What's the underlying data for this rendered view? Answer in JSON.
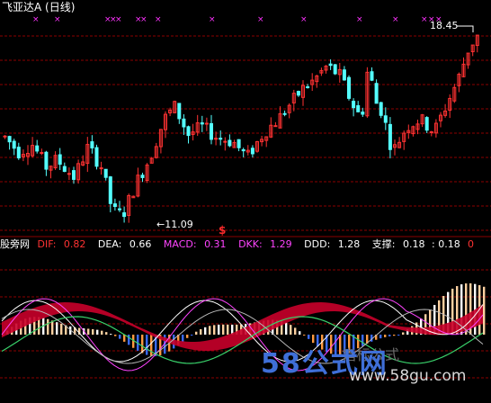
{
  "window": {
    "title": "飞亚达A (日线)"
  },
  "price_panel": {
    "high_label": "18.45",
    "low_label": "←11.09",
    "signal_marker": "$"
  },
  "indicator_panel": {
    "name": "股旁网",
    "items": [
      {
        "label": "DIF:",
        "value": "0.82",
        "color": "#ff3333"
      },
      {
        "label": "DEA:",
        "value": "0.66",
        "color": "#ffffff"
      },
      {
        "label": "MACD:",
        "value": "0.31",
        "color": "#ff44ff"
      },
      {
        "label": "DKK:",
        "value": "1.29",
        "color": "#ff44ff"
      },
      {
        "label": "DDD:",
        "value": "1.28",
        "color": "#ffffff"
      },
      {
        "label": "支撑:",
        "value": "0.18",
        "color": "#ffee55"
      }
    ],
    "right_value": ": 0.18",
    "right_zero": "0"
  },
  "watermark": {
    "main": "58公式网",
    "url": "www.58gu.com",
    "faint": "指标公式"
  },
  "chart_data": {
    "type": "candlestick",
    "title": "飞亚达A (日线)",
    "price_range_visible": [
      11.09,
      18.45
    ],
    "annotated_high": 18.45,
    "annotated_low": 11.09,
    "indicators": {
      "DIF": 0.82,
      "DEA": 0.66,
      "MACD": 0.31,
      "DKK": 1.29,
      "DDD": 1.28,
      "支撑": 0.18
    },
    "colors": {
      "up": "#ff3232",
      "down": "#54ffff",
      "grid": "#8b0000",
      "markers": "#ff33ff"
    }
  }
}
